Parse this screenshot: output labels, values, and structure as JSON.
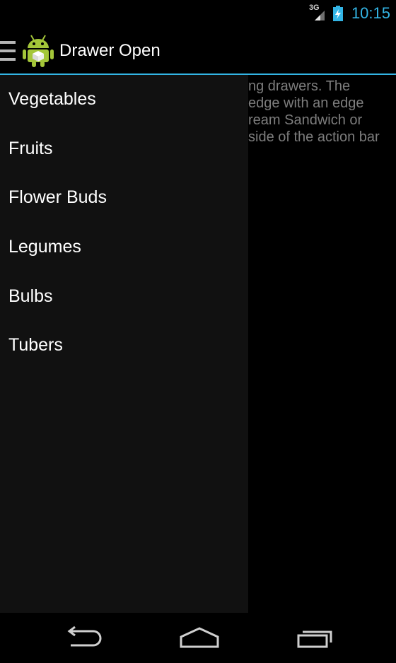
{
  "status_bar": {
    "network_type": "3G",
    "time": "10:15"
  },
  "action_bar": {
    "title": "Drawer Open"
  },
  "drawer": {
    "items": [
      {
        "label": "Vegetables"
      },
      {
        "label": "Fruits"
      },
      {
        "label": "Flower Buds"
      },
      {
        "label": "Legumes"
      },
      {
        "label": "Bulbs"
      },
      {
        "label": "Tubers"
      }
    ]
  },
  "content": {
    "lines": [
      "ng drawers. The",
      "edge with an edge",
      "ream Sandwich or",
      "side of the action bar"
    ]
  },
  "colors": {
    "accent": "#33b5e5",
    "drawer_bg": "#111111",
    "background": "#000000"
  }
}
